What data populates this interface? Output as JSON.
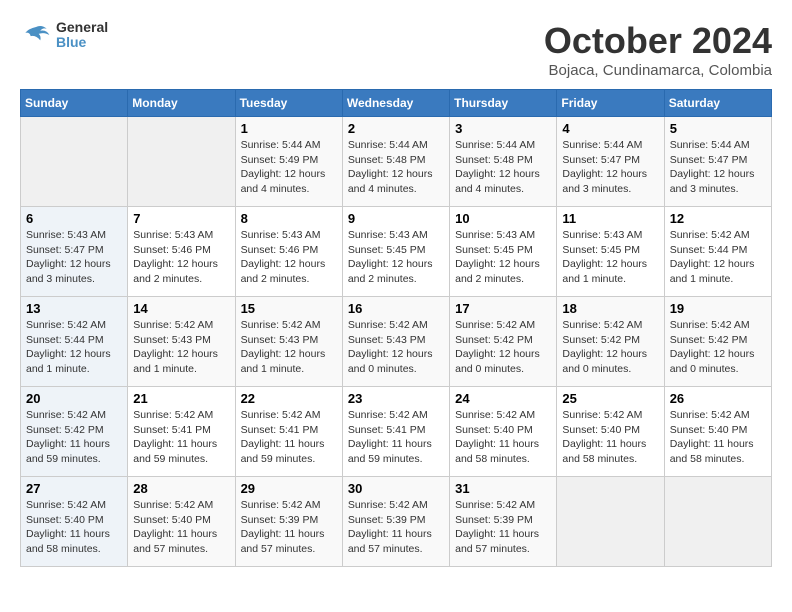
{
  "logo": {
    "line1": "General",
    "line2": "Blue"
  },
  "title": "October 2024",
  "location": "Bojaca, Cundinamarca, Colombia",
  "weekdays": [
    "Sunday",
    "Monday",
    "Tuesday",
    "Wednesday",
    "Thursday",
    "Friday",
    "Saturday"
  ],
  "weeks": [
    [
      {
        "day": "",
        "info": ""
      },
      {
        "day": "",
        "info": ""
      },
      {
        "day": "1",
        "info": "Sunrise: 5:44 AM\nSunset: 5:49 PM\nDaylight: 12 hours\nand 4 minutes."
      },
      {
        "day": "2",
        "info": "Sunrise: 5:44 AM\nSunset: 5:48 PM\nDaylight: 12 hours\nand 4 minutes."
      },
      {
        "day": "3",
        "info": "Sunrise: 5:44 AM\nSunset: 5:48 PM\nDaylight: 12 hours\nand 4 minutes."
      },
      {
        "day": "4",
        "info": "Sunrise: 5:44 AM\nSunset: 5:47 PM\nDaylight: 12 hours\nand 3 minutes."
      },
      {
        "day": "5",
        "info": "Sunrise: 5:44 AM\nSunset: 5:47 PM\nDaylight: 12 hours\nand 3 minutes."
      }
    ],
    [
      {
        "day": "6",
        "info": "Sunrise: 5:43 AM\nSunset: 5:47 PM\nDaylight: 12 hours\nand 3 minutes."
      },
      {
        "day": "7",
        "info": "Sunrise: 5:43 AM\nSunset: 5:46 PM\nDaylight: 12 hours\nand 2 minutes."
      },
      {
        "day": "8",
        "info": "Sunrise: 5:43 AM\nSunset: 5:46 PM\nDaylight: 12 hours\nand 2 minutes."
      },
      {
        "day": "9",
        "info": "Sunrise: 5:43 AM\nSunset: 5:45 PM\nDaylight: 12 hours\nand 2 minutes."
      },
      {
        "day": "10",
        "info": "Sunrise: 5:43 AM\nSunset: 5:45 PM\nDaylight: 12 hours\nand 2 minutes."
      },
      {
        "day": "11",
        "info": "Sunrise: 5:43 AM\nSunset: 5:45 PM\nDaylight: 12 hours\nand 1 minute."
      },
      {
        "day": "12",
        "info": "Sunrise: 5:42 AM\nSunset: 5:44 PM\nDaylight: 12 hours\nand 1 minute."
      }
    ],
    [
      {
        "day": "13",
        "info": "Sunrise: 5:42 AM\nSunset: 5:44 PM\nDaylight: 12 hours\nand 1 minute."
      },
      {
        "day": "14",
        "info": "Sunrise: 5:42 AM\nSunset: 5:43 PM\nDaylight: 12 hours\nand 1 minute."
      },
      {
        "day": "15",
        "info": "Sunrise: 5:42 AM\nSunset: 5:43 PM\nDaylight: 12 hours\nand 1 minute."
      },
      {
        "day": "16",
        "info": "Sunrise: 5:42 AM\nSunset: 5:43 PM\nDaylight: 12 hours\nand 0 minutes."
      },
      {
        "day": "17",
        "info": "Sunrise: 5:42 AM\nSunset: 5:42 PM\nDaylight: 12 hours\nand 0 minutes."
      },
      {
        "day": "18",
        "info": "Sunrise: 5:42 AM\nSunset: 5:42 PM\nDaylight: 12 hours\nand 0 minutes."
      },
      {
        "day": "19",
        "info": "Sunrise: 5:42 AM\nSunset: 5:42 PM\nDaylight: 12 hours\nand 0 minutes."
      }
    ],
    [
      {
        "day": "20",
        "info": "Sunrise: 5:42 AM\nSunset: 5:42 PM\nDaylight: 11 hours\nand 59 minutes."
      },
      {
        "day": "21",
        "info": "Sunrise: 5:42 AM\nSunset: 5:41 PM\nDaylight: 11 hours\nand 59 minutes."
      },
      {
        "day": "22",
        "info": "Sunrise: 5:42 AM\nSunset: 5:41 PM\nDaylight: 11 hours\nand 59 minutes."
      },
      {
        "day": "23",
        "info": "Sunrise: 5:42 AM\nSunset: 5:41 PM\nDaylight: 11 hours\nand 59 minutes."
      },
      {
        "day": "24",
        "info": "Sunrise: 5:42 AM\nSunset: 5:40 PM\nDaylight: 11 hours\nand 58 minutes."
      },
      {
        "day": "25",
        "info": "Sunrise: 5:42 AM\nSunset: 5:40 PM\nDaylight: 11 hours\nand 58 minutes."
      },
      {
        "day": "26",
        "info": "Sunrise: 5:42 AM\nSunset: 5:40 PM\nDaylight: 11 hours\nand 58 minutes."
      }
    ],
    [
      {
        "day": "27",
        "info": "Sunrise: 5:42 AM\nSunset: 5:40 PM\nDaylight: 11 hours\nand 58 minutes."
      },
      {
        "day": "28",
        "info": "Sunrise: 5:42 AM\nSunset: 5:40 PM\nDaylight: 11 hours\nand 57 minutes."
      },
      {
        "day": "29",
        "info": "Sunrise: 5:42 AM\nSunset: 5:39 PM\nDaylight: 11 hours\nand 57 minutes."
      },
      {
        "day": "30",
        "info": "Sunrise: 5:42 AM\nSunset: 5:39 PM\nDaylight: 11 hours\nand 57 minutes."
      },
      {
        "day": "31",
        "info": "Sunrise: 5:42 AM\nSunset: 5:39 PM\nDaylight: 11 hours\nand 57 minutes."
      },
      {
        "day": "",
        "info": ""
      },
      {
        "day": "",
        "info": ""
      }
    ]
  ]
}
